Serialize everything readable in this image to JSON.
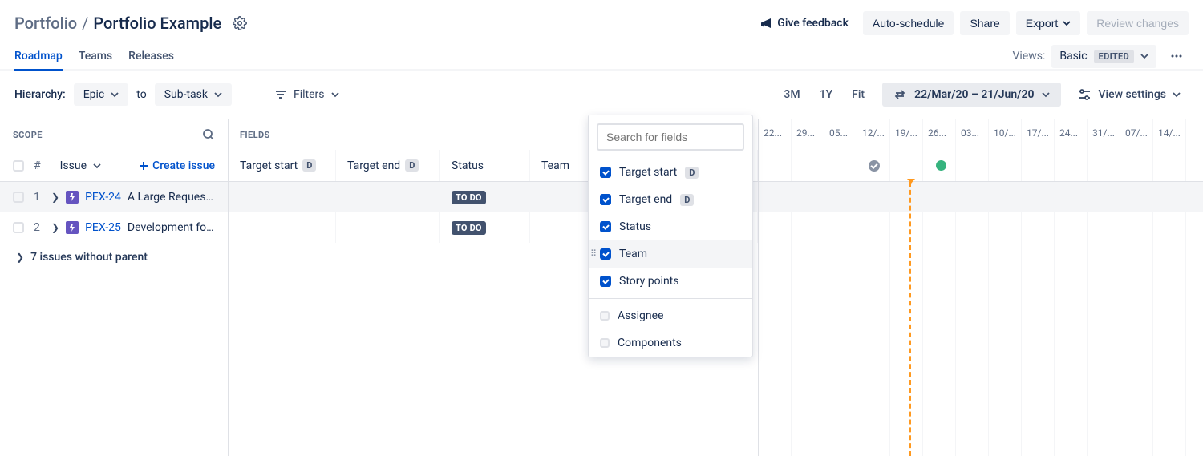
{
  "breadcrumb": {
    "root": "Portfolio",
    "current": "Portfolio Example"
  },
  "header": {
    "feedback": "Give feedback",
    "auto_schedule": "Auto-schedule",
    "share": "Share",
    "export": "Export",
    "review_changes": "Review changes"
  },
  "tabs": {
    "roadmap": "Roadmap",
    "teams": "Teams",
    "releases": "Releases"
  },
  "views": {
    "label": "Views:",
    "current": "Basic",
    "edited": "EDITED"
  },
  "toolbar": {
    "hierarchy_label": "Hierarchy:",
    "level_top": "Epic",
    "to_label": "to",
    "level_bottom": "Sub-task",
    "filters_label": "Filters",
    "zoom_3m": "3M",
    "zoom_1y": "1Y",
    "zoom_fit": "Fit",
    "date_range": "22/Mar/20 – 21/Jun/20",
    "view_settings": "View settings"
  },
  "scope": {
    "header": "SCOPE",
    "hash": "#",
    "issue_label": "Issue",
    "create_issue": "Create issue",
    "without_parent": "7 issues without parent"
  },
  "fields_header": "FIELDS",
  "columns": {
    "target_start": "Target start",
    "target_end": "Target end",
    "status": "Status",
    "team": "Team"
  },
  "d_badge": "D",
  "rows": [
    {
      "num": "1",
      "key": "PEX-24",
      "summary": "A Large Request...",
      "status": "TO DO"
    },
    {
      "num": "2",
      "key": "PEX-25",
      "summary": "Development for...",
      "status": "TO DO"
    }
  ],
  "timeline": {
    "weeks": [
      "22...",
      "29...",
      "05...",
      "12/...",
      "19/...",
      "26...",
      "03...",
      "10/...",
      "17/...",
      "24...",
      "31/...",
      "07/...",
      "14/..."
    ]
  },
  "popover": {
    "search_placeholder": "Search for fields",
    "items_checked": [
      {
        "label": "Target start",
        "badge": true
      },
      {
        "label": "Target end",
        "badge": true
      },
      {
        "label": "Status",
        "badge": false
      },
      {
        "label": "Team",
        "badge": false,
        "selected": true
      },
      {
        "label": "Story points",
        "badge": false
      }
    ],
    "items_unchecked": [
      {
        "label": "Assignee"
      },
      {
        "label": "Components"
      }
    ]
  }
}
